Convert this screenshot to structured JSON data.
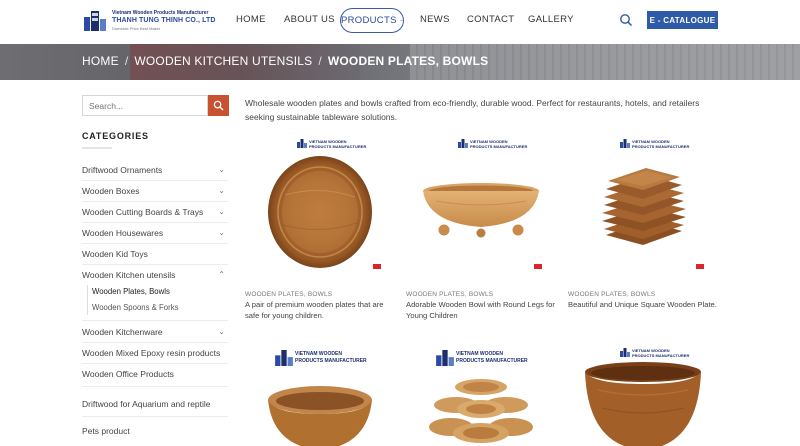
{
  "header": {
    "logo": {
      "line1": "Vietnam Wooden Products Manufacturer",
      "line2": "THANH TUNG THINH CO., LTD",
      "line3": "Domestic Price Best Maker"
    },
    "nav": [
      {
        "label": "HOME"
      },
      {
        "label": "ABOUT US"
      },
      {
        "label": "PRODUCTS"
      },
      {
        "label": "NEWS"
      },
      {
        "label": "CONTACT"
      },
      {
        "label": "GALLERY"
      }
    ],
    "catalogue_label": "E - CATALOGUE"
  },
  "breadcrumb": {
    "home": "HOME",
    "parent": "WOODEN KITCHEN UTENSILS",
    "current": "WOODEN PLATES, BOWLS",
    "sep": "/"
  },
  "sidebar": {
    "search_placeholder": "Search...",
    "categories_title": "CATEGORIES",
    "categories": [
      {
        "label": "Driftwood Ornaments",
        "chevron": "⌄"
      },
      {
        "label": "Wooden Boxes",
        "chevron": "⌄"
      },
      {
        "label": "Wooden Cutting Boards & Trays",
        "chevron": "⌄"
      },
      {
        "label": "Wooden Housewares",
        "chevron": "⌄"
      },
      {
        "label": "Wooden Kid Toys",
        "chevron": ""
      },
      {
        "label": "Wooden Kitchen utensils",
        "chevron": "⌃"
      },
      {
        "label": "Wooden Kitchenware",
        "chevron": "⌄"
      },
      {
        "label": "Wooden Mixed Epoxy resin products",
        "chevron": ""
      },
      {
        "label": "Wooden Office Products",
        "chevron": ""
      },
      {
        "label": "Driftwood for Aquarium and reptile",
        "chevron": ""
      },
      {
        "label": "Pets product",
        "chevron": ""
      }
    ],
    "subcategories": [
      {
        "label": "Wooden Plates, Bowls"
      },
      {
        "label": "Wooden Spoons & Forks"
      }
    ]
  },
  "content": {
    "intro": "Wholesale wooden plates and bowls crafted from eco-friendly, durable wood. Perfect for restaurants, hotels, and retailers seeking sustainable tableware solutions.",
    "watermark": "VIETNAM WOODEN PRODUCTS MANUFACTURER",
    "watermark_line1": "VIETNAM WOODEN",
    "watermark_line2": "PRODUCTS MANUFACTURER",
    "products": [
      {
        "category": "WOODEN PLATES, BOWLS",
        "title": "A pair of premium wooden plates that are safe for young children."
      },
      {
        "category": "WOODEN PLATES, BOWLS",
        "title": "Adorable Wooden Bowl with Round Legs for Young Children"
      },
      {
        "category": "WOODEN PLATES, BOWLS",
        "title": "Beautiful and Unique Square Wooden Plate."
      }
    ]
  },
  "colors": {
    "accent": "#2e5aa8",
    "search_button": "#c8512f",
    "wood_light": "#c98a4b",
    "wood_dark": "#8a4f22"
  }
}
